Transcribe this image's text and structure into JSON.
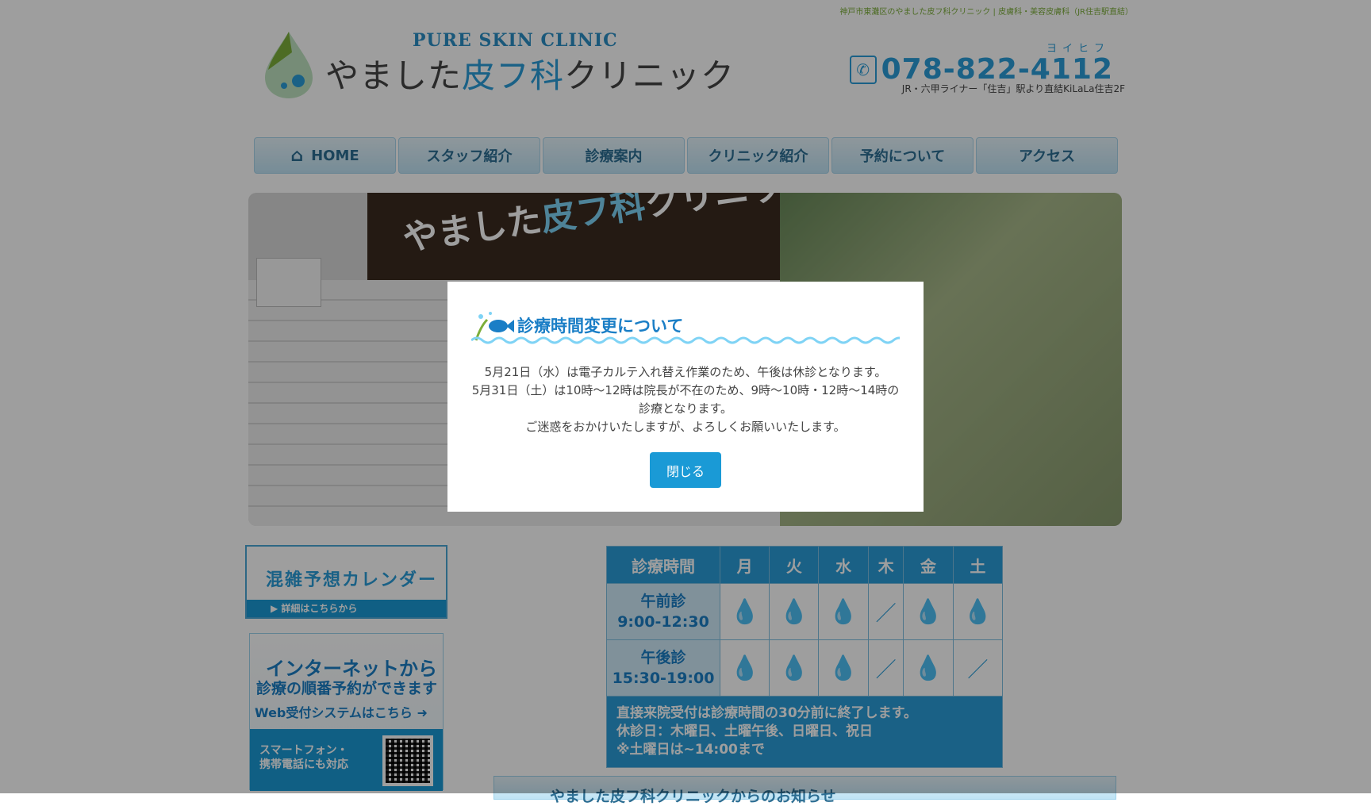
{
  "header": {
    "tagline": "神戸市東灘区のやました皮フ科クリニック | 皮膚科・美容皮膚科（JR住吉駅直結）",
    "logo_en": "PURE SKIN CLINIC",
    "logo_jp_1": "やました",
    "logo_jp_2": "皮フ科",
    "logo_jp_3": "クリニック",
    "phone_kana": "ヨイヒフ",
    "phone_number": "078-822-4112",
    "address": "JR・六甲ライナー「住吉」駅より直結KiLaLa住吉2F"
  },
  "nav": {
    "items": [
      {
        "label": "HOME"
      },
      {
        "label": "スタッフ紹介"
      },
      {
        "label": "診療案内"
      },
      {
        "label": "クリニック紹介"
      },
      {
        "label": "予約について"
      },
      {
        "label": "アクセス"
      }
    ]
  },
  "hero": {
    "sign_1": "やました",
    "sign_2": "皮フ科",
    "sign_3": "クリニック"
  },
  "modal": {
    "title": "診療時間変更について",
    "line1": "5月21日（水）は電子カルテ入れ替え作業のため、午後は休診となります。",
    "line2": "5月31日（土）は10時～12時は院長が不在のため、9時～10時・12時～14時の診療となります。",
    "line3": "ご迷惑をおかけいたしますが、よろしくお願いいたします。",
    "close_label": "閉じる"
  },
  "sidebar": {
    "calendar_title": "混雑予想カレンダー",
    "calendar_link": "▶ 詳細はこちらから",
    "web_line1": "インターネットから",
    "web_line2": "診療の順番予約ができます",
    "web_line3": "Web受付システムはこちら ➜",
    "web_smart_1": "スマートフォン・",
    "web_smart_2": "携帯電話にも対応"
  },
  "hours": {
    "header": [
      "診療時間",
      "月",
      "火",
      "水",
      "木",
      "金",
      "土"
    ],
    "rows": [
      {
        "label_1": "午前診",
        "label_2": "9:00-12:30",
        "cells": [
          "open",
          "open",
          "open",
          "closed",
          "open",
          "open"
        ]
      },
      {
        "label_1": "午後診",
        "label_2": "15:30-19:00",
        "cells": [
          "open",
          "open",
          "open",
          "closed",
          "open",
          "closed"
        ]
      }
    ],
    "note_1": "直接来院受付は診療時間の30分前に終了します。",
    "note_2": "休診日：木曜日、土曜午後、日曜日、祝日",
    "note_3": "※土曜日は~14:00まで",
    "open_icon": "drop-icon",
    "closed_icon": "slash-icon"
  },
  "news": {
    "title": "やました皮フ科クリニックからのお知らせ"
  },
  "colors": {
    "accent": "#1a9ad6",
    "brand": "#2a9dd8"
  }
}
